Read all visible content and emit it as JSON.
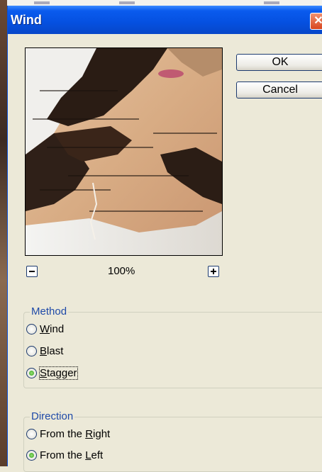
{
  "dialog": {
    "title": "Wind",
    "close_glyph": "✕"
  },
  "buttons": {
    "ok_label": "OK",
    "cancel_label": "Cancel"
  },
  "zoom": {
    "value": "100%",
    "minus_icon": "minus-icon",
    "plus_icon": "plus-icon"
  },
  "method": {
    "legend": "Method",
    "options": [
      {
        "pre": "",
        "mnemonic": "W",
        "post": "ind",
        "checked": false
      },
      {
        "pre": "",
        "mnemonic": "B",
        "post": "last",
        "checked": false
      },
      {
        "pre": "",
        "mnemonic": "S",
        "post": "tagger",
        "checked": true
      }
    ]
  },
  "direction": {
    "legend": "Direction",
    "options": [
      {
        "pre": "From the ",
        "mnemonic": "R",
        "post": "ight",
        "checked": false
      },
      {
        "pre": "From the ",
        "mnemonic": "L",
        "post": "eft",
        "checked": true
      }
    ]
  },
  "colors": {
    "title_bar": "#0550e0",
    "group_label": "#1f4aa8",
    "radio_checked": "#2aa012",
    "close_button": "#d8461e"
  }
}
